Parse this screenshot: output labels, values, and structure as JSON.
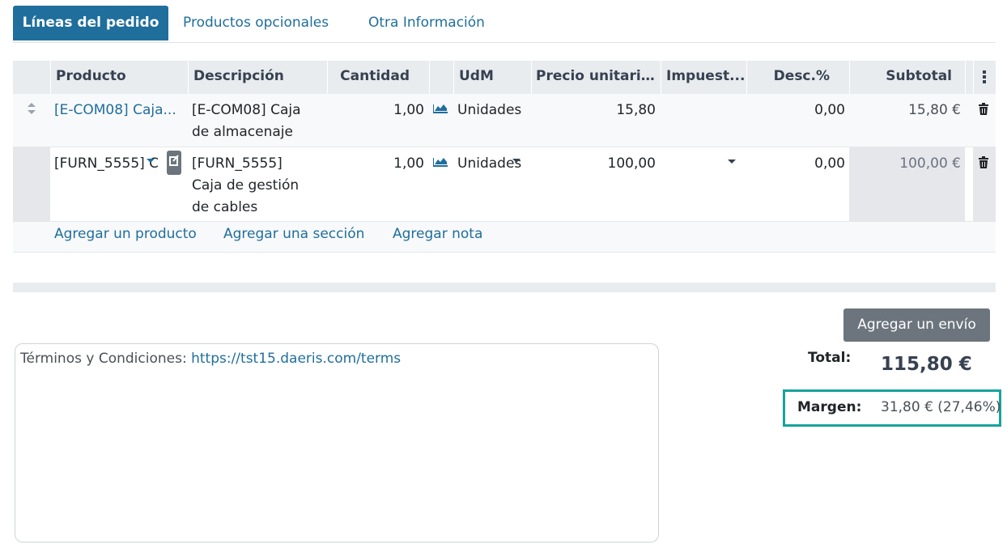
{
  "tabs": [
    {
      "label": "Líneas del pedido",
      "active": true
    },
    {
      "label": "Productos opcionales",
      "active": false
    },
    {
      "label": "Otra Información",
      "active": false
    }
  ],
  "table": {
    "headers": {
      "product": "Producto",
      "description": "Descripción",
      "quantity": "Cantidad",
      "uom": "UdM",
      "unit_price": "Precio unitario...",
      "taxes": "Impuest...",
      "discount": "Desc.%",
      "subtotal": "Subtotal"
    },
    "rows": [
      {
        "product": "[E-COM08] Caja...",
        "description_line1": "[E-COM08] Caja",
        "description_line2": "de almacenaje",
        "quantity": "1,00",
        "uom": "Unidades",
        "unit_price": "15,80",
        "taxes": "",
        "discount": "0,00",
        "subtotal": "15,80 €"
      },
      {
        "product": "[FURN_5555] C",
        "description_line1": "[FURN_5555]",
        "description_line2": "Caja de gestión",
        "description_line3": "de cables",
        "quantity": "1,00",
        "uom": "Unidades",
        "unit_price": "100,00",
        "taxes": "",
        "discount": "0,00",
        "subtotal": "100,00 €"
      }
    ],
    "add_links": {
      "add_product": "Agregar un producto",
      "add_section": "Agregar una sección",
      "add_note": "Agregar nota"
    }
  },
  "shipping_button": "Agregar un envío",
  "terms": {
    "label": "Términos y Condiciones: ",
    "url": "https://tst15.daeris.com/terms"
  },
  "totals": {
    "total_label": "Total:",
    "total_value": "115,80 €",
    "margin_label": "Margen:",
    "margin_value": "31,80 € (27,46%)"
  },
  "colors": {
    "accent": "#1f6e9c",
    "highlight_border": "#17a39a",
    "button_gray": "#6c757d"
  }
}
